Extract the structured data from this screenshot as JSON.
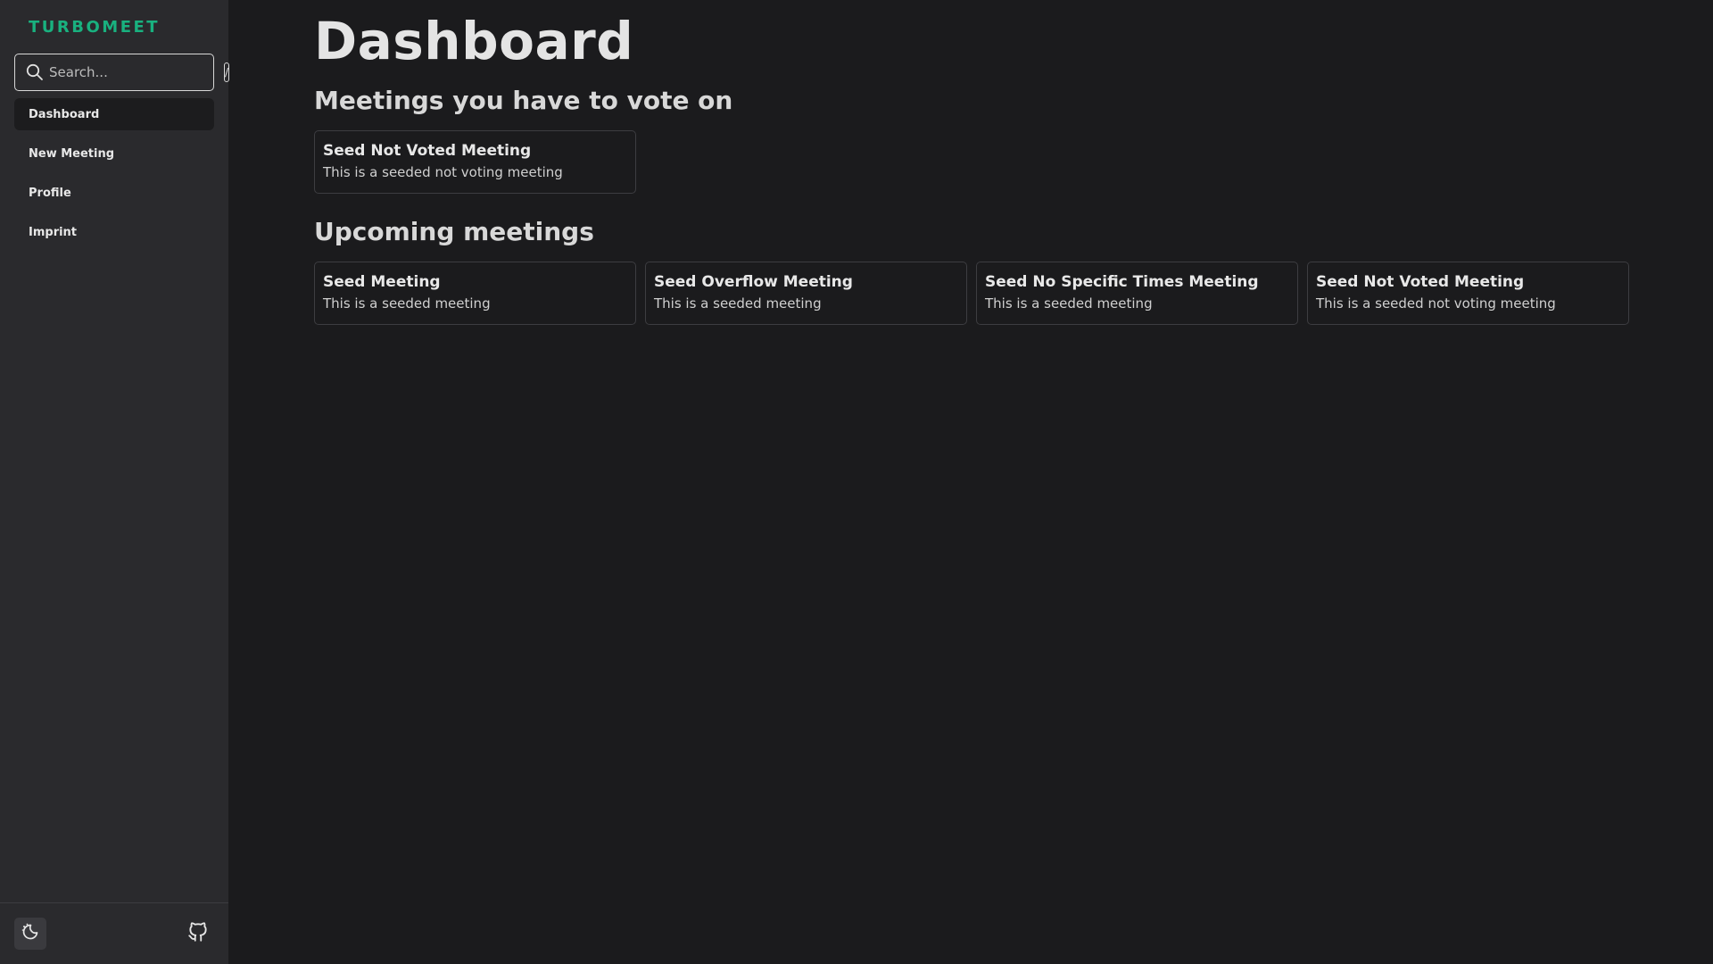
{
  "app": {
    "brand": "TURBOMEET",
    "accent_color": "#19b17f"
  },
  "search": {
    "placeholder": "Search...",
    "shortcut": "/"
  },
  "sidebar": {
    "items": [
      {
        "label": "Dashboard",
        "active": true
      },
      {
        "label": "New Meeting",
        "active": false
      },
      {
        "label": "Profile",
        "active": false
      },
      {
        "label": "Imprint",
        "active": false
      }
    ],
    "footer": {
      "theme_icon": "theme-toggle-icon",
      "github_icon": "github-icon"
    }
  },
  "main": {
    "title": "Dashboard",
    "vote_section": {
      "title": "Meetings you have to vote on",
      "meetings": [
        {
          "title": "Seed Not Voted Meeting",
          "description": "This is a seeded not voting meeting"
        }
      ]
    },
    "upcoming_section": {
      "title": "Upcoming meetings",
      "meetings": [
        {
          "title": "Seed Meeting",
          "description": "This is a seeded meeting"
        },
        {
          "title": "Seed Overflow Meeting",
          "description": "This is a seeded meeting"
        },
        {
          "title": "Seed No Specific Times Meeting",
          "description": "This is a seeded meeting"
        },
        {
          "title": "Seed Not Voted Meeting",
          "description": "This is a seeded not voting meeting"
        }
      ]
    }
  }
}
